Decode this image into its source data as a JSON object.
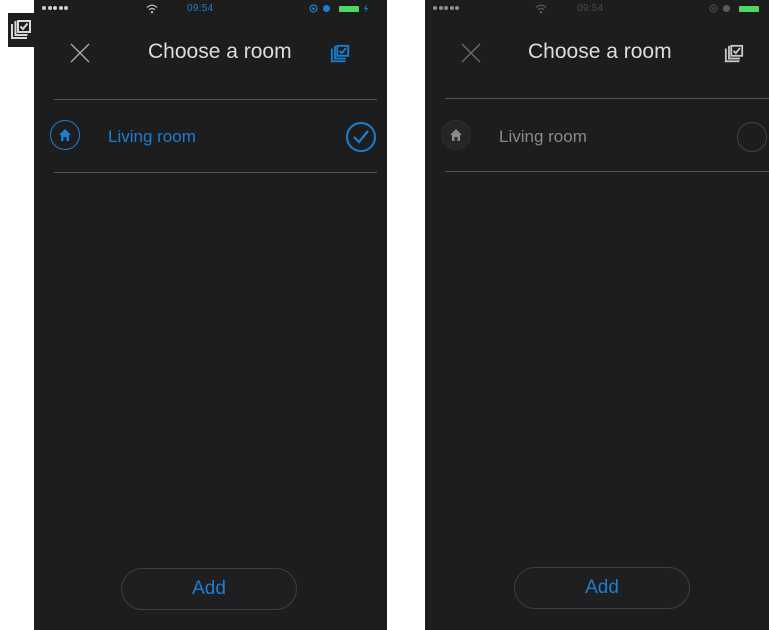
{
  "status_bar": {
    "time": "09:54"
  },
  "screens": [
    {
      "nav": {
        "title": "Choose a room"
      },
      "rooms": [
        {
          "label": "Living room",
          "selected": true
        }
      ],
      "add_button": {
        "label": "Add"
      }
    },
    {
      "nav": {
        "title": "Choose a room"
      },
      "rooms": [
        {
          "label": "Living room",
          "selected": false
        }
      ],
      "add_button": {
        "label": "Add"
      }
    }
  ],
  "icons": {
    "close": "close-icon",
    "select_all": "select-all-icon",
    "home": "home-icon",
    "check": "check-icon",
    "wifi": "wifi-icon",
    "battery": "battery-icon"
  },
  "colors": {
    "background": "#1d1d1e",
    "accent": "#1a7fd3",
    "text_inactive": "#8a8a8a",
    "title": "#dcdcdc",
    "battery": "#4cd964"
  }
}
